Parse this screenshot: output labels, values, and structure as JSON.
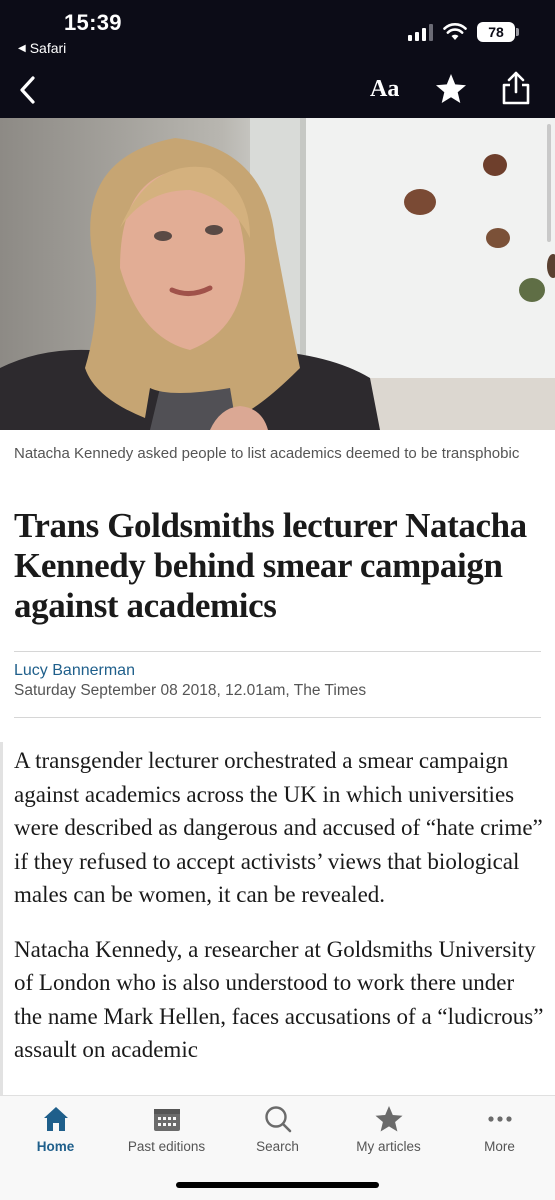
{
  "status_bar": {
    "time": "15:39",
    "back_app": "Safari",
    "battery": "78"
  },
  "nav": {
    "text_size_label": "Aa",
    "icons": [
      "back-chevron-icon",
      "star-icon",
      "share-icon"
    ]
  },
  "article": {
    "caption": "Natacha Kennedy asked people to list academics deemed to be transphobic",
    "headline": "Trans Goldsmiths lecturer Natacha Kennedy behind smear campaign against academics",
    "author": "Lucy Bannerman",
    "dateline": "Saturday September 08 2018, 12.01am, The Times",
    "paragraphs": [
      "A transgender lecturer orchestrated a smear campaign against academics across the UK in which universities were described as dangerous and accused of “hate crime” if they refused to accept activists’ views that biological males can be women, it can be revealed.",
      "Natacha Kennedy, a researcher at Goldsmiths University of London who is also understood to work there under the name Mark Hellen, faces accusations of a “ludicrous” assault on academic"
    ]
  },
  "tabbar": {
    "tabs": [
      {
        "label": "Home",
        "icon": "home-icon",
        "active": true
      },
      {
        "label": "Past editions",
        "icon": "calendar-icon",
        "active": false
      },
      {
        "label": "Search",
        "icon": "search-icon",
        "active": false
      },
      {
        "label": "My articles",
        "icon": "star-icon",
        "active": false
      },
      {
        "label": "More",
        "icon": "more-dots-icon",
        "active": false
      }
    ]
  },
  "colors": {
    "topbar_bg": "#0c0c17",
    "link_blue": "#1f5f8b",
    "tab_active": "#1f5f8b"
  }
}
